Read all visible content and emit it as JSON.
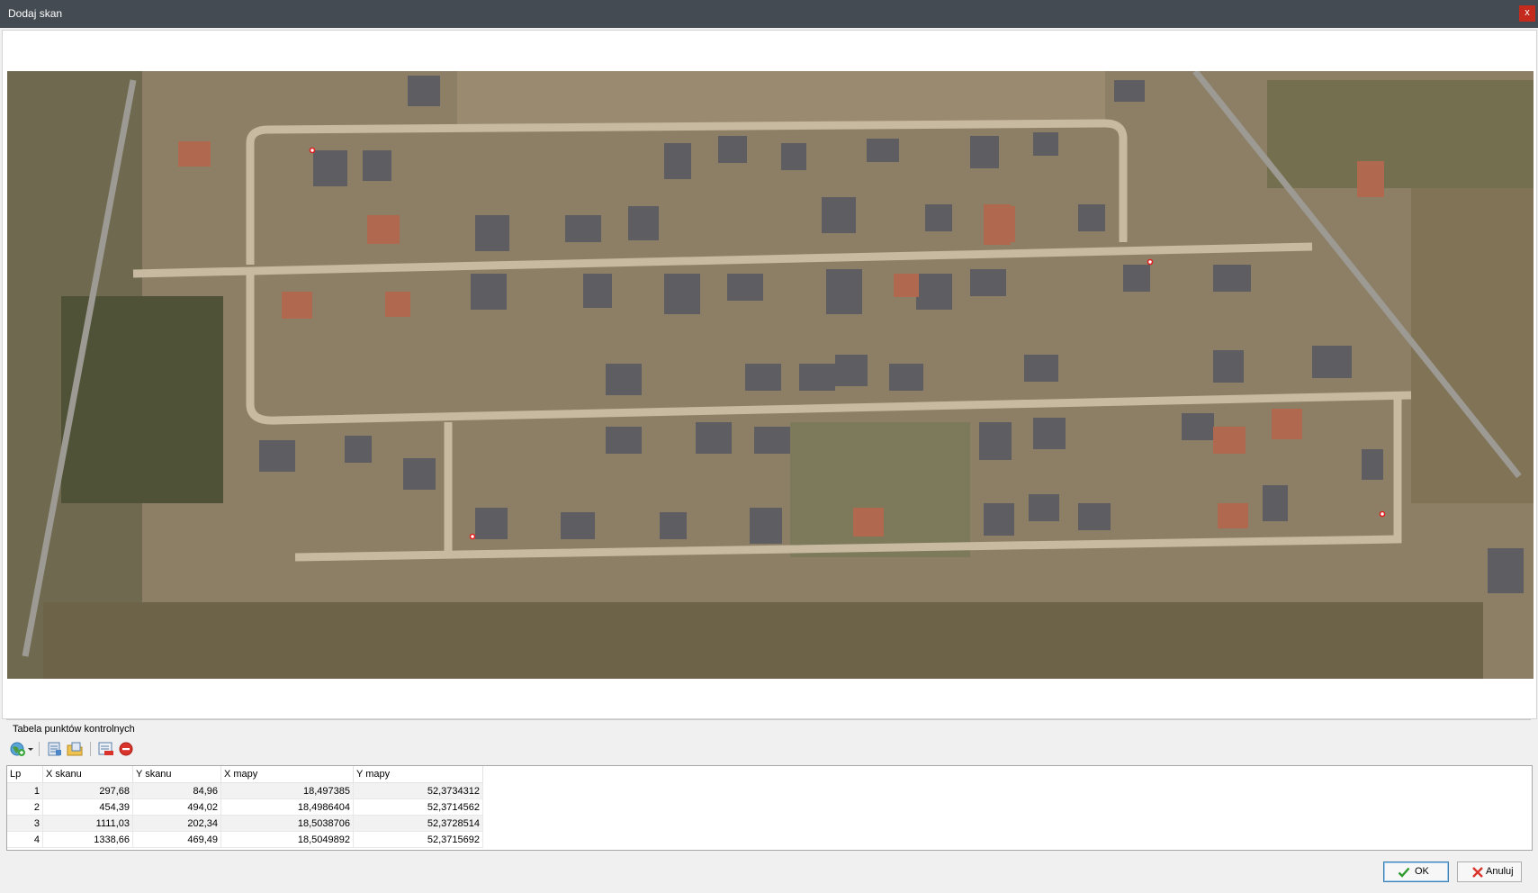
{
  "window": {
    "title": "Dodaj skan",
    "close_label": "x"
  },
  "viewer": {
    "image": "aerial-orthophoto-residential-area"
  },
  "control_points": {
    "group_title": "Tabela punktów kontrolnych",
    "columns": [
      "Lp",
      "X skanu",
      "Y skanu",
      "X mapy",
      "Y mapy"
    ],
    "rows": [
      [
        "1",
        "297,68",
        "84,96",
        "18,497385",
        "52,3734312"
      ],
      [
        "2",
        "454,39",
        "494,02",
        "18,4986404",
        "52,3714562"
      ],
      [
        "3",
        "1111,03",
        "202,34",
        "18,5038706",
        "52,3728514"
      ],
      [
        "4",
        "1338,66",
        "469,49",
        "18,5049892",
        "52,3715692"
      ]
    ]
  },
  "toolbar": {
    "icons": [
      "add-point-globe-icon",
      "dropdown-arrow-icon",
      "import-icon",
      "export-icon",
      "edit-icon",
      "delete-icon"
    ]
  },
  "buttons": {
    "ok": "OK",
    "cancel": "Anuluj"
  },
  "colors": {
    "titlebar": "#444b52",
    "close": "#c42b1c",
    "accent": "#3c7fb1",
    "delete": "#d9342b",
    "ok_check": "#2e9a2e",
    "cancel_x": "#d9342b"
  }
}
